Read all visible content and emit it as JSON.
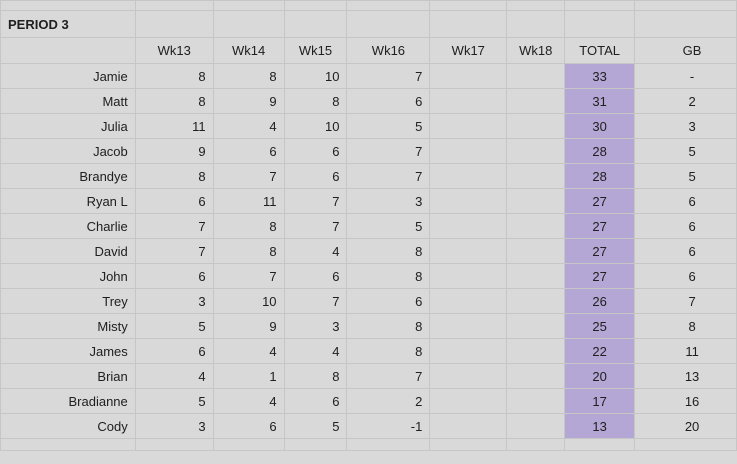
{
  "sheet": {
    "title": "PERIOD 3",
    "headers": [
      "",
      "Wk13",
      "Wk14",
      "Wk15",
      "Wk16",
      "Wk17",
      "Wk18",
      "TOTAL",
      "GB"
    ],
    "rows": [
      {
        "name": "Jamie",
        "wk13": "8",
        "wk14": "8",
        "wk15": "10",
        "wk16": "7",
        "wk17": "",
        "wk18": "",
        "total": "33",
        "gb": "-"
      },
      {
        "name": "Matt",
        "wk13": "8",
        "wk14": "9",
        "wk15": "8",
        "wk16": "6",
        "wk17": "",
        "wk18": "",
        "total": "31",
        "gb": "2"
      },
      {
        "name": "Julia",
        "wk13": "11",
        "wk14": "4",
        "wk15": "10",
        "wk16": "5",
        "wk17": "",
        "wk18": "",
        "total": "30",
        "gb": "3"
      },
      {
        "name": "Jacob",
        "wk13": "9",
        "wk14": "6",
        "wk15": "6",
        "wk16": "7",
        "wk17": "",
        "wk18": "",
        "total": "28",
        "gb": "5"
      },
      {
        "name": "Brandye",
        "wk13": "8",
        "wk14": "7",
        "wk15": "6",
        "wk16": "7",
        "wk17": "",
        "wk18": "",
        "total": "28",
        "gb": "5"
      },
      {
        "name": "Ryan L",
        "wk13": "6",
        "wk14": "11",
        "wk15": "7",
        "wk16": "3",
        "wk17": "",
        "wk18": "",
        "total": "27",
        "gb": "6"
      },
      {
        "name": "Charlie",
        "wk13": "7",
        "wk14": "8",
        "wk15": "7",
        "wk16": "5",
        "wk17": "",
        "wk18": "",
        "total": "27",
        "gb": "6"
      },
      {
        "name": "David",
        "wk13": "7",
        "wk14": "8",
        "wk15": "4",
        "wk16": "8",
        "wk17": "",
        "wk18": "",
        "total": "27",
        "gb": "6"
      },
      {
        "name": "John",
        "wk13": "6",
        "wk14": "7",
        "wk15": "6",
        "wk16": "8",
        "wk17": "",
        "wk18": "",
        "total": "27",
        "gb": "6"
      },
      {
        "name": "Trey",
        "wk13": "3",
        "wk14": "10",
        "wk15": "7",
        "wk16": "6",
        "wk17": "",
        "wk18": "",
        "total": "26",
        "gb": "7"
      },
      {
        "name": "Misty",
        "wk13": "5",
        "wk14": "9",
        "wk15": "3",
        "wk16": "8",
        "wk17": "",
        "wk18": "",
        "total": "25",
        "gb": "8"
      },
      {
        "name": "James",
        "wk13": "6",
        "wk14": "4",
        "wk15": "4",
        "wk16": "8",
        "wk17": "",
        "wk18": "",
        "total": "22",
        "gb": "11"
      },
      {
        "name": "Brian",
        "wk13": "4",
        "wk14": "1",
        "wk15": "8",
        "wk16": "7",
        "wk17": "",
        "wk18": "",
        "total": "20",
        "gb": "13"
      },
      {
        "name": "Bradianne",
        "wk13": "5",
        "wk14": "4",
        "wk15": "6",
        "wk16": "2",
        "wk17": "",
        "wk18": "",
        "total": "17",
        "gb": "16"
      },
      {
        "name": "Cody",
        "wk13": "3",
        "wk14": "6",
        "wk15": "5",
        "wk16": "-1",
        "wk17": "",
        "wk18": "",
        "total": "13",
        "gb": "20"
      }
    ]
  },
  "colors": {
    "background": "#d9d9d9",
    "grid": "#c6c6c6",
    "total_highlight": "#b4a7d6"
  }
}
